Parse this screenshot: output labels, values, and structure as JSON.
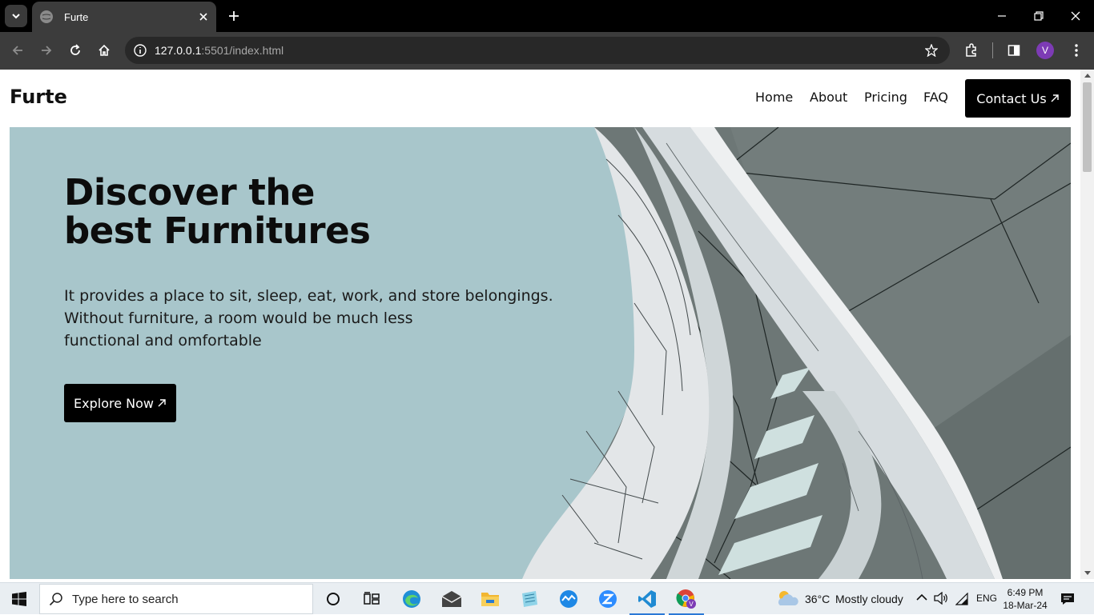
{
  "browser": {
    "tab": {
      "title": "Furte"
    },
    "url": {
      "host": "127.0.0.1",
      "rest": ":5501/index.html"
    },
    "profile_initial": "V"
  },
  "site": {
    "logo": "Furte",
    "nav": [
      "Home",
      "About",
      "Pricing",
      "FAQ"
    ],
    "contact_label": "Contact Us",
    "hero": {
      "title_lines": [
        "Discover the",
        "best Furnitures"
      ],
      "description_lines": [
        "It provides a place to sit, sleep, eat, work, and store belongings.",
        "Without furniture, a room would be much less",
        "functional and omfortable"
      ],
      "cta_label": "Explore Now"
    },
    "colors": {
      "hero_bg": "#a8c6cb",
      "button_bg": "#000000",
      "text": "#111111"
    }
  },
  "taskbar": {
    "search_placeholder": "Type here to search",
    "weather_temp": "36°C",
    "weather_desc": "Mostly cloudy",
    "language": "ENG",
    "time": "6:49 PM",
    "date": "18-Mar-24",
    "apps": [
      "task-view",
      "edge",
      "mail",
      "file-explorer",
      "notepad",
      "app-blue",
      "zoom",
      "vscode",
      "chrome"
    ]
  }
}
